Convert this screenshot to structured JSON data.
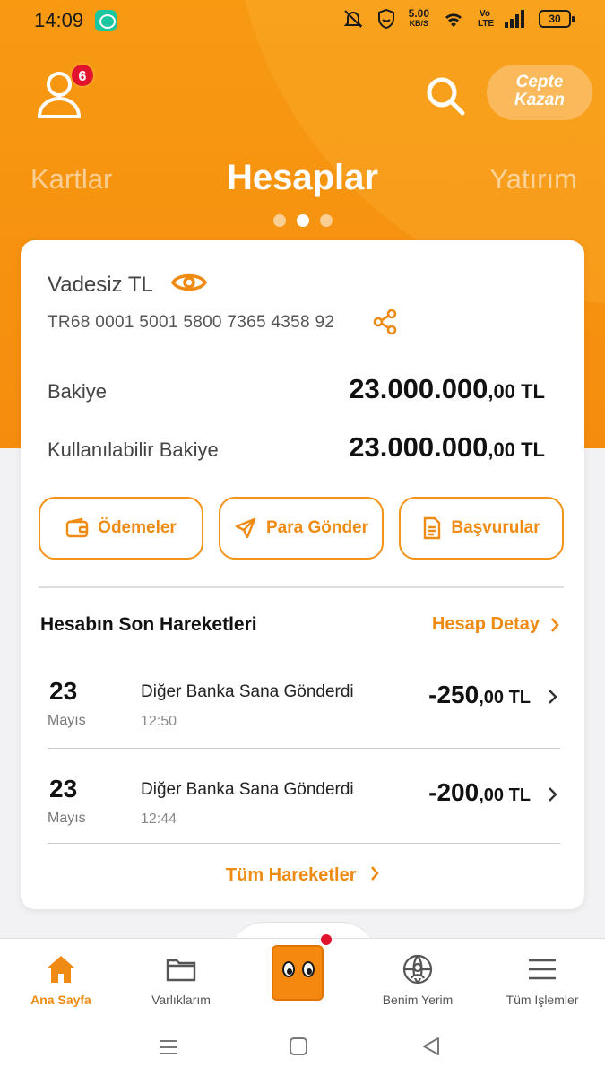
{
  "status": {
    "time": "14:09",
    "speed_top": "5.00",
    "speed_bottom": "KB/S",
    "network": "Vo LTE",
    "battery": "30"
  },
  "header": {
    "notification_count": "6",
    "cepte_line1": "Cepte",
    "cepte_line2": "Kazan",
    "tabs": [
      "Kartlar",
      "Hesaplar",
      "Yatırım"
    ],
    "active_tab": "Hesaplar",
    "brand_color": "#f68c0e"
  },
  "account": {
    "name": "Vadesiz TL",
    "iban": "TR68 0001 5001 5800 7365 4358 92",
    "balance_label": "Bakiye",
    "balance_int": "23.000.000",
    "balance_dec": ",00 TL",
    "available_label": "Kullanılabilir Bakiye",
    "available_int": "23.000.000",
    "available_dec": ",00 TL"
  },
  "actions": [
    {
      "label": "Ödemeler",
      "icon": "wallet-icon"
    },
    {
      "label": "Para Gönder",
      "icon": "send-icon"
    },
    {
      "label": "Başvurular",
      "icon": "document-icon"
    }
  ],
  "transactions_section": {
    "title": "Hesabın Son Hareketleri",
    "detail_link": "Hesap Detay",
    "all_link": "Tüm Hareketler",
    "items": [
      {
        "day": "23",
        "month": "Mayıs",
        "desc": "Diğer Banka Sana Gönderdi",
        "time": "12:50",
        "amount_int": "-250",
        "amount_dec": ",00 TL"
      },
      {
        "day": "23",
        "month": "Mayıs",
        "desc": "Diğer Banka Sana Gönderdi",
        "time": "12:44",
        "amount_int": "-200",
        "amount_dec": ",00 TL"
      }
    ]
  },
  "bottom_nav": [
    {
      "label": "Ana Sayfa",
      "icon": "home-icon",
      "active": true
    },
    {
      "label": "Varlıklarım",
      "icon": "folder-icon",
      "active": false
    },
    {
      "label": "",
      "icon": "mascot-icon",
      "active": false
    },
    {
      "label": "Benim Yerim",
      "icon": "globe-user-icon",
      "active": false
    },
    {
      "label": "Tüm İşlemler",
      "icon": "menu-icon",
      "active": false
    }
  ]
}
